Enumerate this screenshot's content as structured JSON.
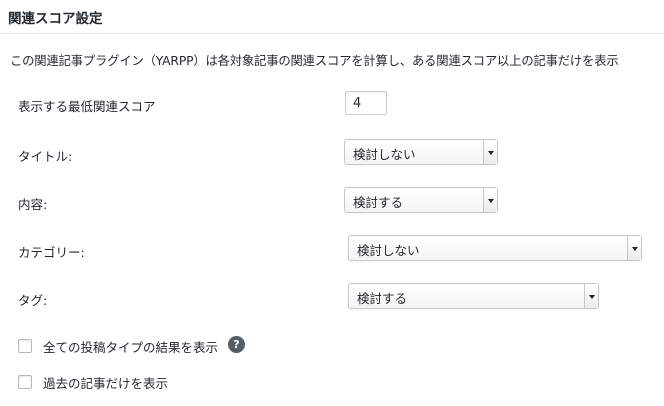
{
  "panel": {
    "title": "関連スコア設定",
    "description": "この関連記事プラグイン（YARPP）は各対象記事の関連スコアを計算し、ある関連スコア以上の記事だけを表示"
  },
  "settings": {
    "min_score": {
      "label": "表示する最低関連スコア",
      "value": "4"
    },
    "title_match": {
      "label": "タイトル:",
      "selected": "検討しない"
    },
    "body_match": {
      "label": "内容:",
      "selected": "検討する"
    },
    "category_match": {
      "label": "カテゴリー:",
      "selected": "検討しない"
    },
    "tag_match": {
      "label": "タグ:",
      "selected": "検討する"
    }
  },
  "checkboxes": {
    "all_post_types": {
      "label": "全ての投稿タイプの結果を表示",
      "checked": false,
      "help_icon": "question-mark",
      "help_glyph": "?"
    },
    "past_only": {
      "label": "過去の記事だけを表示",
      "checked": false
    }
  }
}
